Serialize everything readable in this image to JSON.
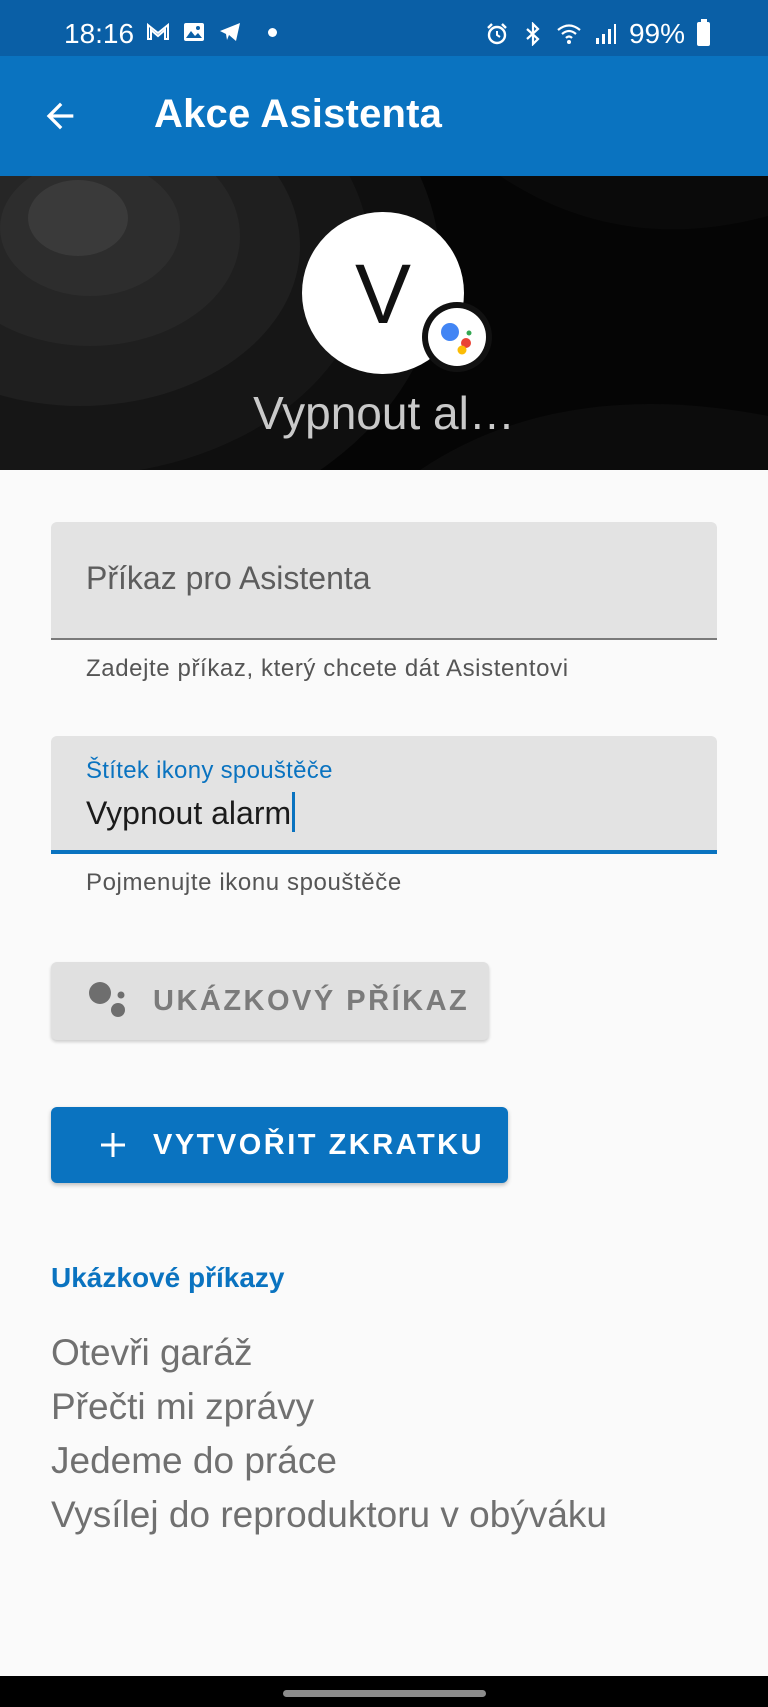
{
  "status_bar": {
    "time": "18:16",
    "battery": "99%",
    "left_icons": [
      "gmail-icon",
      "gallery-icon",
      "telegram-icon",
      "notification-dot"
    ],
    "right_icons": [
      "alarm-icon",
      "bluetooth-icon",
      "wifi-icon",
      "signal-icon",
      "battery-icon"
    ]
  },
  "app_bar": {
    "title": "Akce Asistenta",
    "back_icon": "arrow-back-icon"
  },
  "banner": {
    "avatar_letter": "V",
    "name": "Vypnout al…",
    "badge_icon": "google-assistant-icon"
  },
  "form": {
    "command_field": {
      "placeholder": "Příkaz pro Asistenta",
      "helper": "Zadejte příkaz, který chcete dát Asistentovi"
    },
    "label_field": {
      "label": "Štítek ikony spouštěče",
      "value": "Vypnout alarm",
      "helper": "Pojmenujte ikonu spouštěče"
    }
  },
  "buttons": {
    "sample_command": "UKÁZKOVÝ PŘÍKAZ",
    "create_shortcut": "VYTVOŘIT ZKRATKU"
  },
  "examples": {
    "title": "Ukázkové příkazy",
    "items": [
      "Otevři garáž",
      "Přečti mi zprávy",
      "Jedeme do práce",
      "Vysílej do reproduktoru v obýváku"
    ]
  },
  "colors": {
    "status_bar": "#0a5fa6",
    "app_bar": "#0a73c0",
    "accent": "#0a73c0",
    "assistant_blue": "#4285f4",
    "assistant_red": "#ea4335",
    "assistant_yellow": "#fbbc05",
    "assistant_green": "#34a853"
  }
}
